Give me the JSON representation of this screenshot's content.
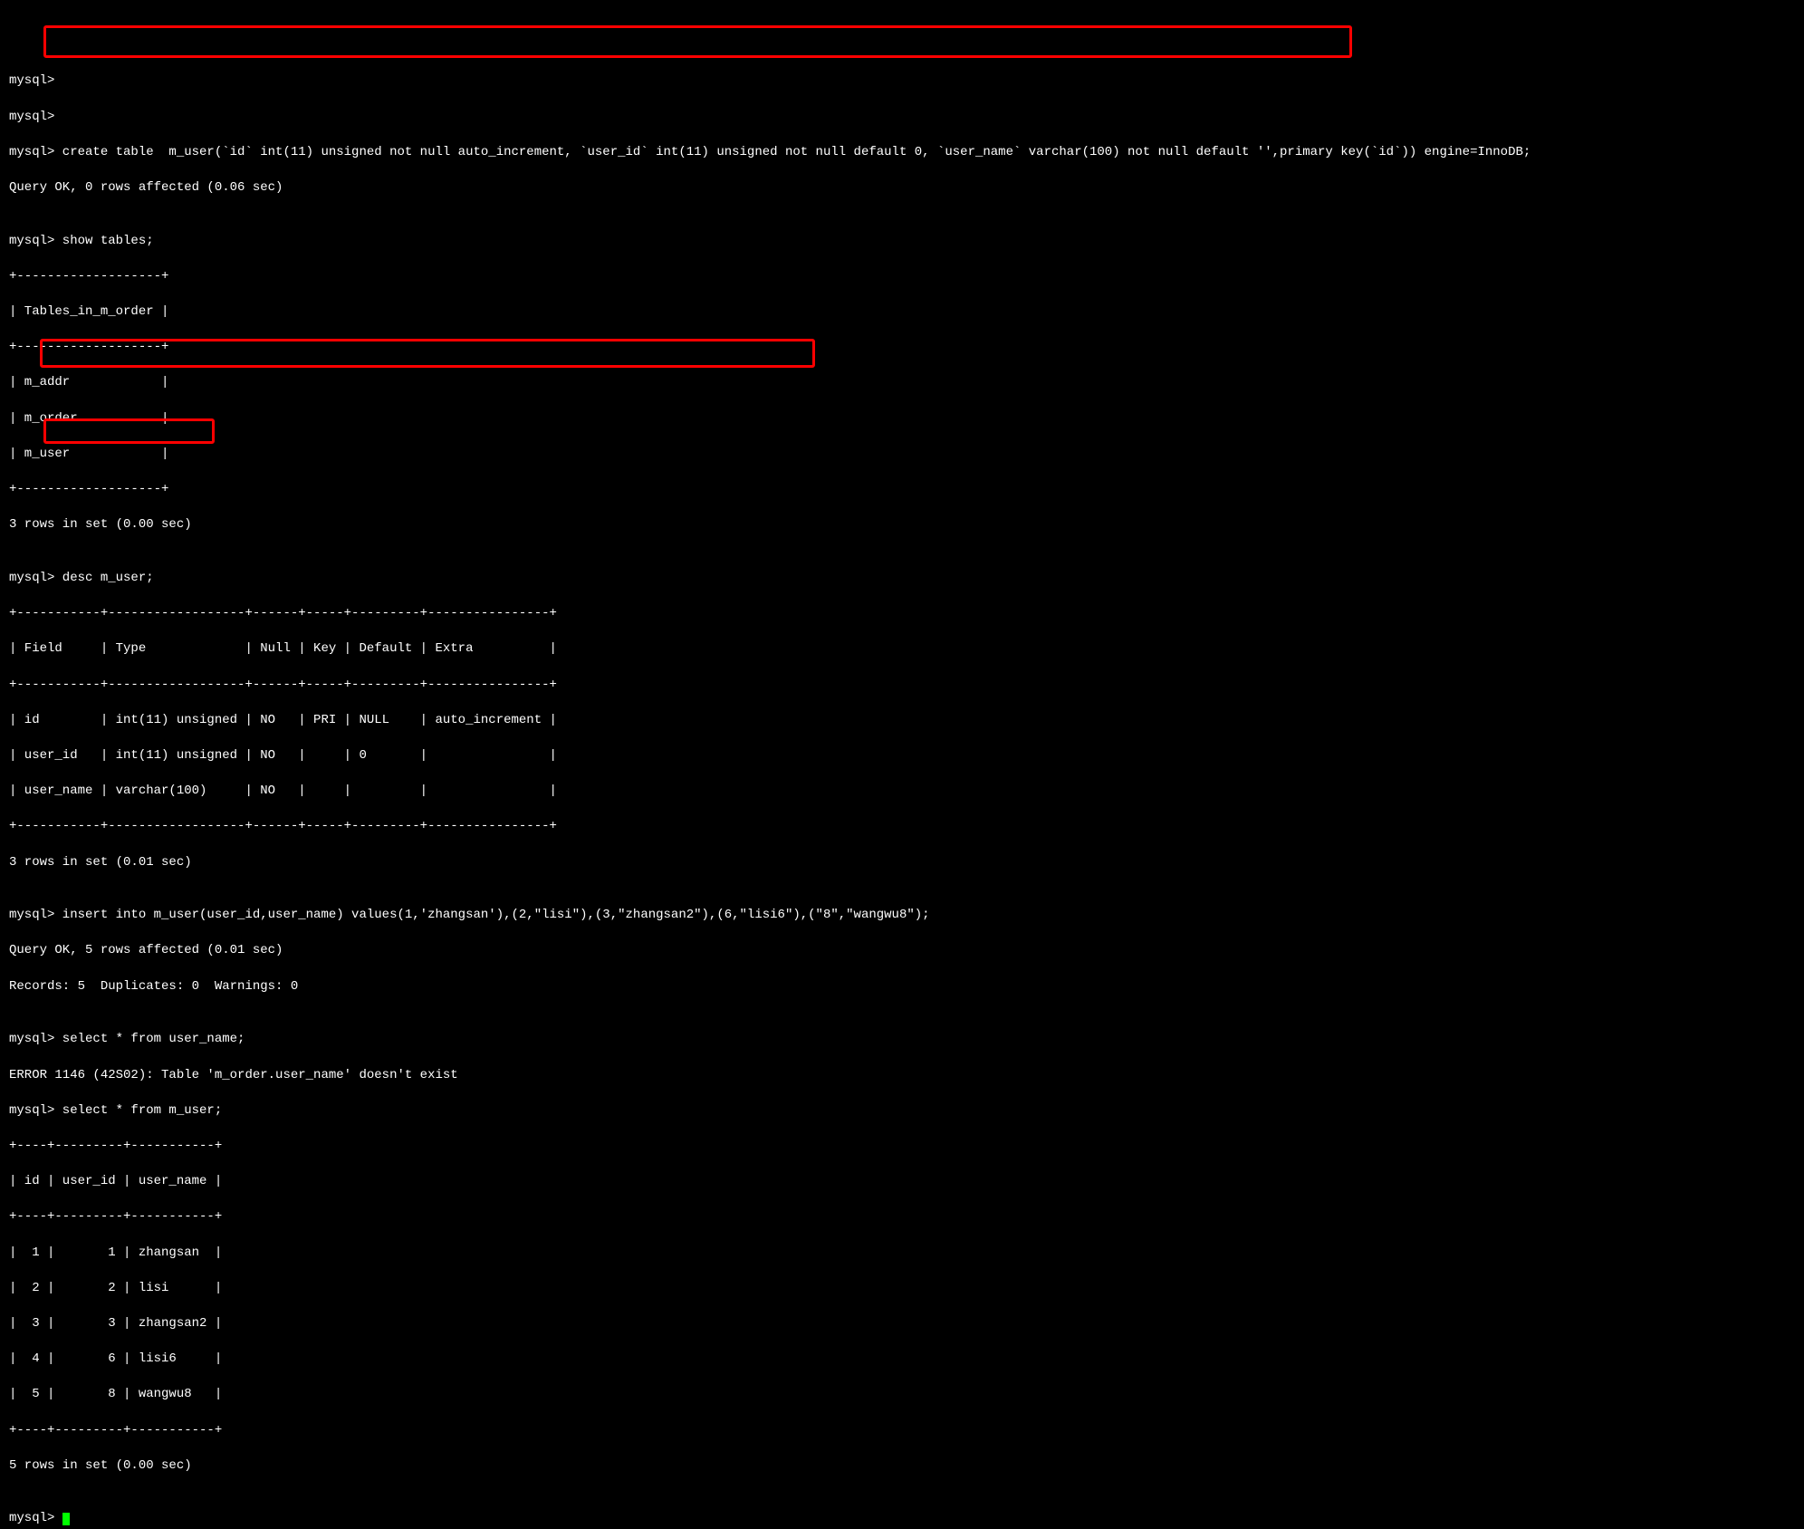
{
  "lines": {
    "l1": "mysql>",
    "l2": "mysql>",
    "l3": "mysql> create table  m_user(`id` int(11) unsigned not null auto_increment, `user_id` int(11) unsigned not null default 0, `user_name` varchar(100) not null default '',primary key(`id`)) engine=InnoDB;",
    "l4": "Query OK, 0 rows affected (0.06 sec)",
    "l5": "",
    "l6": "mysql> show tables;",
    "l7": "+-------------------+",
    "l8": "| Tables_in_m_order |",
    "l9": "+-------------------+",
    "l10": "| m_addr            |",
    "l11": "| m_order           |",
    "l12": "| m_user            |",
    "l13": "+-------------------+",
    "l14": "3 rows in set (0.00 sec)",
    "l15": "",
    "l16": "mysql> desc m_user;",
    "l17": "+-----------+------------------+------+-----+---------+----------------+",
    "l18": "| Field     | Type             | Null | Key | Default | Extra          |",
    "l19": "+-----------+------------------+------+-----+---------+----------------+",
    "l20": "| id        | int(11) unsigned | NO   | PRI | NULL    | auto_increment |",
    "l21": "| user_id   | int(11) unsigned | NO   |     | 0       |                |",
    "l22": "| user_name | varchar(100)     | NO   |     |         |                |",
    "l23": "+-----------+------------------+------+-----+---------+----------------+",
    "l24": "3 rows in set (0.01 sec)",
    "l25": "",
    "l26": "mysql> insert into m_user(user_id,user_name) values(1,'zhangsan'),(2,\"lisi\"),(3,\"zhangsan2\"),(6,\"lisi6\"),(\"8\",\"wangwu8\");",
    "l27": "Query OK, 5 rows affected (0.01 sec)",
    "l28": "Records: 5  Duplicates: 0  Warnings: 0",
    "l29": "",
    "l30": "mysql> select * from user_name;",
    "l31": "ERROR 1146 (42S02): Table 'm_order.user_name' doesn't exist",
    "l32": "mysql> select * from m_user;",
    "l33": "+----+---------+-----------+",
    "l34": "| id | user_id | user_name |",
    "l35": "+----+---------+-----------+",
    "l36": "|  1 |       1 | zhangsan  |",
    "l37": "|  2 |       2 | lisi      |",
    "l38": "|  3 |       3 | zhangsan2 |",
    "l39": "|  4 |       6 | lisi6     |",
    "l40": "|  5 |       8 | wangwu8   |",
    "l41": "+----+---------+-----------+",
    "l42": "5 rows in set (0.00 sec)",
    "l43": "",
    "l44": "mysql> "
  }
}
